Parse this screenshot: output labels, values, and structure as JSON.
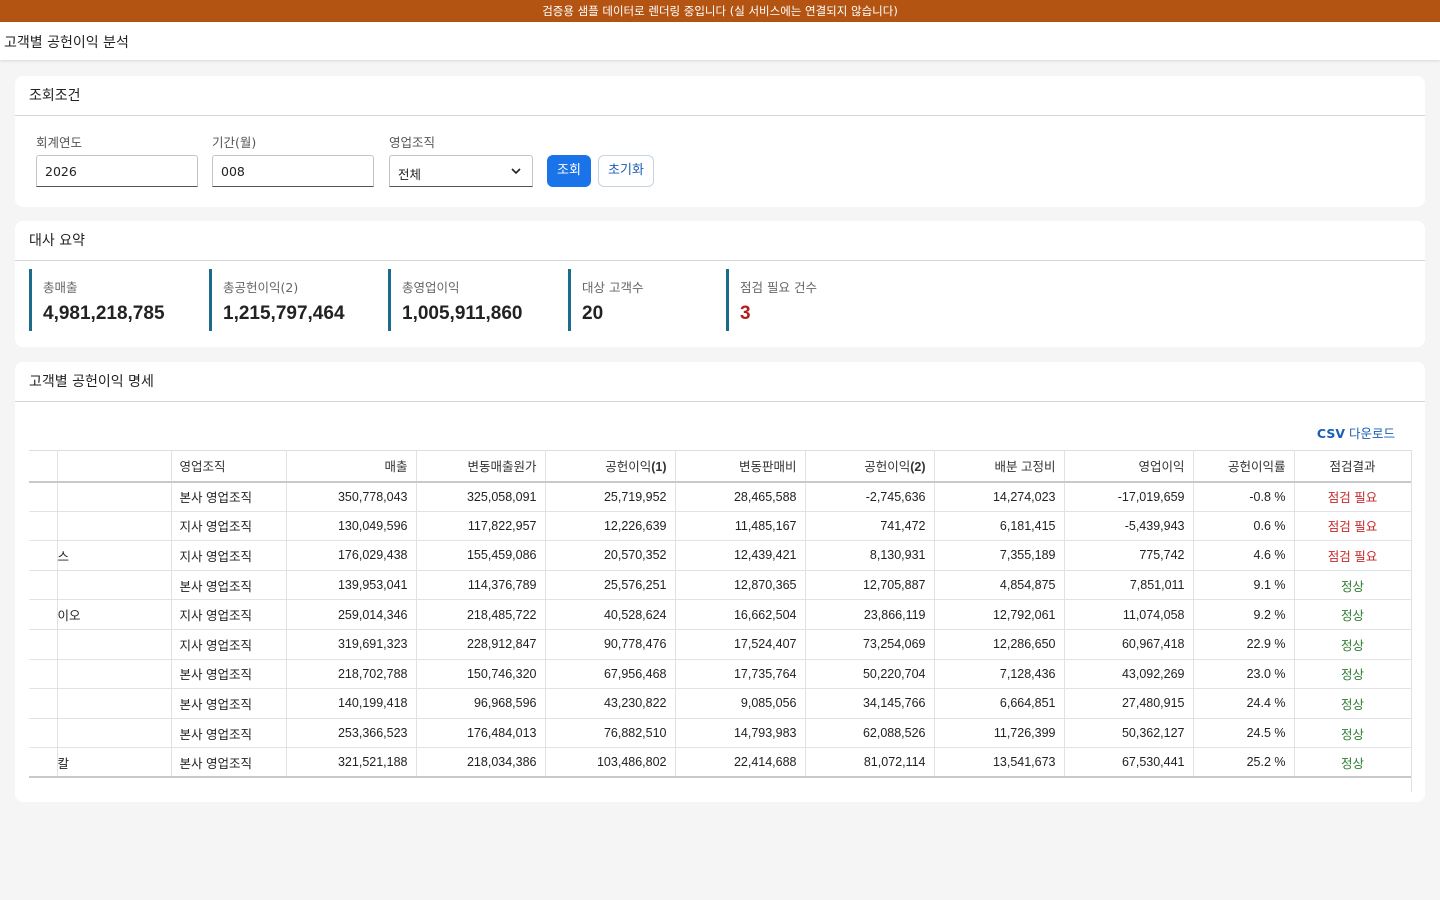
{
  "banner": "검증용 샘플 데이터로 렌더링 중입니다 (실 서비스에는 연결되지 않습니다)",
  "page_title": "고객별 공헌이익 분석",
  "conditions": {
    "title": "조회조건",
    "fiscal_year": {
      "label": "회계연도",
      "value": "2026"
    },
    "period": {
      "label": "기간(월)",
      "value": "008"
    },
    "org": {
      "label": "영업조직",
      "value": "전체"
    },
    "search_btn": "조회",
    "reset_btn": "초기화"
  },
  "summary": {
    "title": "대사 요약",
    "kpis": [
      {
        "label": "총매출",
        "value": "4,981,218,785"
      },
      {
        "label": "총공헌이익(2)",
        "value": "1,215,797,464"
      },
      {
        "label": "총영업이익",
        "value": "1,005,911,860"
      },
      {
        "label": "대상 고객수",
        "value": "20"
      },
      {
        "label": "점검 필요 건수",
        "value": "3"
      }
    ]
  },
  "detail": {
    "title": "고객별 공헌이익 명세",
    "csv_prefix": "CSV",
    "csv_suffix": " 다운로드",
    "columns": [
      "",
      "",
      "영업조직",
      "매출",
      "변동매출원가",
      "공헌이익",
      "(1)",
      "변동판매비",
      "공헌이익",
      "(2)",
      "배분 고정비",
      "영업이익",
      "공헌이익률",
      "점검결과"
    ],
    "rows": [
      [
        "",
        "",
        "본사 영업조직",
        "350,778,043",
        "325,058,091",
        "25,719,952",
        "28,465,588",
        "-2,745,636",
        "14,274,023",
        "-17,019,659",
        "-0.8 %",
        "점검 필요"
      ],
      [
        "",
        "",
        "지사 영업조직",
        "130,049,596",
        "117,822,957",
        "12,226,639",
        "11,485,167",
        "741,472",
        "6,181,415",
        "-5,439,943",
        "0.6 %",
        "점검 필요"
      ],
      [
        "",
        "스",
        "지사 영업조직",
        "176,029,438",
        "155,459,086",
        "20,570,352",
        "12,439,421",
        "8,130,931",
        "7,355,189",
        "775,742",
        "4.6 %",
        "점검 필요"
      ],
      [
        "",
        "",
        "본사 영업조직",
        "139,953,041",
        "114,376,789",
        "25,576,251",
        "12,870,365",
        "12,705,887",
        "4,854,875",
        "7,851,011",
        "9.1 %",
        "정상"
      ],
      [
        "",
        "이오",
        "지사 영업조직",
        "259,014,346",
        "218,485,722",
        "40,528,624",
        "16,662,504",
        "23,866,119",
        "12,792,061",
        "11,074,058",
        "9.2 %",
        "정상"
      ],
      [
        "",
        "",
        "지사 영업조직",
        "319,691,323",
        "228,912,847",
        "90,778,476",
        "17,524,407",
        "73,254,069",
        "12,286,650",
        "60,967,418",
        "22.9 %",
        "정상"
      ],
      [
        "",
        "",
        "본사 영업조직",
        "218,702,788",
        "150,746,320",
        "67,956,468",
        "17,735,764",
        "50,220,704",
        "7,128,436",
        "43,092,269",
        "23.0 %",
        "정상"
      ],
      [
        "",
        "",
        "본사 영업조직",
        "140,199,418",
        "96,968,596",
        "43,230,822",
        "9,085,056",
        "34,145,766",
        "6,664,851",
        "27,480,915",
        "24.4 %",
        "정상"
      ],
      [
        "",
        "",
        "본사 영업조직",
        "253,366,523",
        "176,484,013",
        "76,882,510",
        "14,793,983",
        "62,088,526",
        "11,726,399",
        "50,362,127",
        "24.5 %",
        "정상"
      ],
      [
        "",
        "칼",
        "본사 영업조직",
        "321,521,188",
        "218,034,386",
        "103,486,802",
        "22,414,688",
        "81,072,114",
        "13,541,673",
        "67,530,441",
        "25.2 %",
        "정상"
      ]
    ]
  }
}
